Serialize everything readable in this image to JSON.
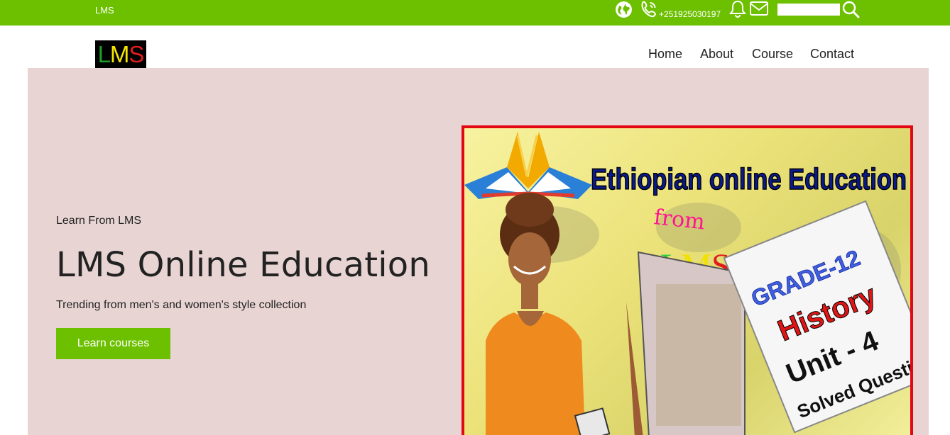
{
  "topbar": {
    "brand": "LMS",
    "phone": "+251925030197",
    "search_placeholder": "",
    "icons": [
      "globe-icon",
      "phone-icon",
      "bell-icon",
      "mail-icon",
      "search-icon"
    ]
  },
  "nav": {
    "logo": {
      "l1": "L",
      "l2": "M",
      "l3": "S"
    },
    "items": [
      "Home",
      "About",
      "Course",
      "Contact"
    ]
  },
  "hero": {
    "eyebrow": "Learn From LMS",
    "title": "LMS Online Education",
    "subtitle": "Trending from men's and women's style collection",
    "cta": "Learn courses"
  },
  "banner": {
    "headline": "Ethiopian online Education",
    "from": "from",
    "lms_l1": "L",
    "lms_l2": "M",
    "lms_l3": "S",
    "grade": "GRADE-12",
    "subject": "History",
    "unit": "Unit - 4",
    "note": "Solved Questions"
  },
  "colors": {
    "accent": "#6cc000",
    "hero_bg": "#e8d5d3",
    "banner_border": "#e30613"
  }
}
